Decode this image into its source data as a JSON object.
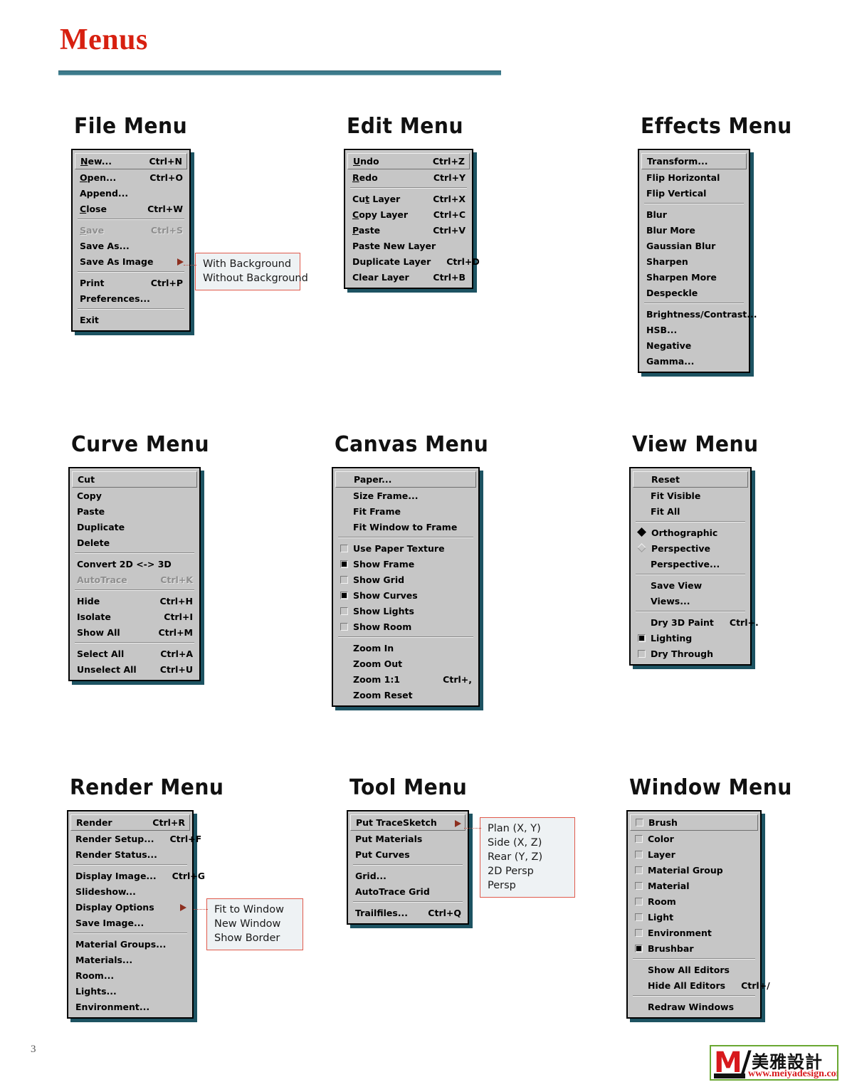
{
  "page": {
    "title": "Menus",
    "page_number": "3"
  },
  "logo": {
    "mark": "M",
    "slash": "/",
    "chinese": "美雅設計",
    "url": "www.meiyadesign.com",
    "border_color": "#6aa832",
    "red": "#d7191c"
  },
  "colors": {
    "title_red": "#d72010",
    "rule_teal": "#3d7b8c",
    "menu_face": "#c6c6c6",
    "menu_shadow": "#1d5362",
    "callout_border": "#e05a4c",
    "callout_fill": "#eef2f4",
    "disabled_text": "#8e8e8e"
  },
  "menus": [
    {
      "id": "file",
      "heading": "File Menu",
      "items": [
        {
          "label": "New...",
          "accel": "Ctrl+N",
          "selected": true,
          "mnemonic": 1
        },
        {
          "label": "Open...",
          "accel": "Ctrl+O",
          "mnemonic": 1
        },
        {
          "label": "Append...",
          "accel": ""
        },
        {
          "label": "Close",
          "accel": "Ctrl+W",
          "mnemonic": 1
        },
        {
          "separator": true
        },
        {
          "label": "Save",
          "accel": "Ctrl+S",
          "disabled": true,
          "mnemonic": 1
        },
        {
          "label": "Save As...",
          "accel": ""
        },
        {
          "label": "Save As Image",
          "accel": "",
          "submenu": true
        },
        {
          "separator": true
        },
        {
          "label": "Print",
          "accel": "Ctrl+P"
        },
        {
          "label": "Preferences...",
          "accel": ""
        },
        {
          "separator": true
        },
        {
          "label": "Exit",
          "accel": ""
        }
      ],
      "callout": {
        "lines": [
          "With Background",
          "Without Background"
        ]
      }
    },
    {
      "id": "edit",
      "heading": "Edit Menu",
      "items": [
        {
          "label": "Undo",
          "accel": "Ctrl+Z",
          "selected": true,
          "mnemonic": 1
        },
        {
          "label": "Redo",
          "accel": "Ctrl+Y",
          "mnemonic": 1
        },
        {
          "separator": true
        },
        {
          "label": "Cut Layer",
          "accel": "Ctrl+X",
          "mnemonic": 3
        },
        {
          "label": "Copy Layer",
          "accel": "Ctrl+C",
          "mnemonic": 1
        },
        {
          "label": "Paste",
          "accel": "Ctrl+V",
          "mnemonic": 1
        },
        {
          "label": "Paste New Layer",
          "accel": ""
        },
        {
          "label": "Duplicate Layer",
          "accel": "Ctrl+D"
        },
        {
          "label": "Clear Layer",
          "accel": "Ctrl+B"
        }
      ]
    },
    {
      "id": "effects",
      "heading": "Effects Menu",
      "items": [
        {
          "label": "Transform...",
          "accel": "",
          "selected": true
        },
        {
          "label": "Flip Horizontal",
          "accel": ""
        },
        {
          "label": "Flip Vertical",
          "accel": ""
        },
        {
          "separator": true
        },
        {
          "label": "Blur",
          "accel": ""
        },
        {
          "label": "Blur More",
          "accel": ""
        },
        {
          "label": "Gaussian Blur",
          "accel": ""
        },
        {
          "label": "Sharpen",
          "accel": ""
        },
        {
          "label": "Sharpen More",
          "accel": ""
        },
        {
          "label": "Despeckle",
          "accel": ""
        },
        {
          "separator": true
        },
        {
          "label": "Brightness/Contrast...",
          "accel": ""
        },
        {
          "label": "HSB...",
          "accel": ""
        },
        {
          "label": "Negative",
          "accel": ""
        },
        {
          "label": "Gamma...",
          "accel": ""
        }
      ]
    },
    {
      "id": "curve",
      "heading": "Curve Menu",
      "items": [
        {
          "label": "Cut",
          "accel": "",
          "selected": true
        },
        {
          "label": "Copy",
          "accel": ""
        },
        {
          "label": "Paste",
          "accel": ""
        },
        {
          "label": "Duplicate",
          "accel": ""
        },
        {
          "label": "Delete",
          "accel": ""
        },
        {
          "separator": true
        },
        {
          "label": "Convert 2D <-> 3D",
          "accel": ""
        },
        {
          "label": "AutoTrace",
          "accel": "Ctrl+K",
          "disabled": true
        },
        {
          "separator": true
        },
        {
          "label": "Hide",
          "accel": "Ctrl+H"
        },
        {
          "label": "Isolate",
          "accel": "Ctrl+I"
        },
        {
          "label": "Show All",
          "accel": "Ctrl+M"
        },
        {
          "separator": true
        },
        {
          "label": "Select All",
          "accel": "Ctrl+A"
        },
        {
          "label": "Unselect All",
          "accel": "Ctrl+U"
        }
      ]
    },
    {
      "id": "canvas",
      "heading": "Canvas Menu",
      "items": [
        {
          "label": "Paper...",
          "accel": "",
          "selected": true,
          "indent": true
        },
        {
          "label": "Size Frame...",
          "accel": "",
          "indent": true
        },
        {
          "label": "Fit Frame",
          "accel": "",
          "indent": true
        },
        {
          "label": "Fit Window to Frame",
          "accel": "",
          "indent": true
        },
        {
          "separator": true
        },
        {
          "label": "Use Paper Texture",
          "accel": "",
          "checkbox": false
        },
        {
          "label": "Show Frame",
          "accel": "",
          "checkbox": true
        },
        {
          "label": "Show Grid",
          "accel": "",
          "checkbox": false
        },
        {
          "label": "Show Curves",
          "accel": "",
          "checkbox": true
        },
        {
          "label": "Show Lights",
          "accel": "",
          "checkbox": false
        },
        {
          "label": "Show Room",
          "accel": "",
          "checkbox": false
        },
        {
          "separator": true
        },
        {
          "label": "Zoom In",
          "accel": "",
          "indent": true
        },
        {
          "label": "Zoom Out",
          "accel": "",
          "indent": true
        },
        {
          "label": "Zoom 1:1",
          "accel": "Ctrl+,",
          "indent": true
        },
        {
          "label": "Zoom Reset",
          "accel": "",
          "indent": true
        }
      ]
    },
    {
      "id": "view",
      "heading": "View Menu",
      "items": [
        {
          "label": "Reset",
          "accel": "",
          "selected": true,
          "indent": true
        },
        {
          "label": "Fit Visible",
          "accel": "",
          "indent": true
        },
        {
          "label": "Fit All",
          "accel": "",
          "indent": true
        },
        {
          "separator": true
        },
        {
          "label": "Orthographic",
          "accel": "",
          "radio": true
        },
        {
          "label": "Perspective",
          "accel": "",
          "radio": false
        },
        {
          "label": "Perspective...",
          "accel": "",
          "indent": true
        },
        {
          "separator": true
        },
        {
          "label": "Save View",
          "accel": "",
          "indent": true
        },
        {
          "label": "Views...",
          "accel": "",
          "indent": true
        },
        {
          "separator": true
        },
        {
          "label": "Dry 3D Paint",
          "accel": "Ctrl+.",
          "indent": true
        },
        {
          "label": "Lighting",
          "accel": "",
          "checkbox": true
        },
        {
          "label": "Dry Through",
          "accel": "",
          "checkbox": false
        }
      ]
    },
    {
      "id": "render",
      "heading": "Render Menu",
      "items": [
        {
          "label": "Render",
          "accel": "Ctrl+R",
          "selected": true
        },
        {
          "label": "Render Setup...",
          "accel": "Ctrl+F"
        },
        {
          "label": "Render Status...",
          "accel": ""
        },
        {
          "separator": true
        },
        {
          "label": "Display Image...",
          "accel": "Ctrl+G"
        },
        {
          "label": "Slideshow...",
          "accel": ""
        },
        {
          "label": "Display Options",
          "accel": "",
          "submenu": true
        },
        {
          "label": "Save Image...",
          "accel": ""
        },
        {
          "separator": true
        },
        {
          "label": "Material Groups...",
          "accel": ""
        },
        {
          "label": "Materials...",
          "accel": ""
        },
        {
          "label": "Room...",
          "accel": ""
        },
        {
          "label": "Lights...",
          "accel": ""
        },
        {
          "label": "Environment...",
          "accel": ""
        }
      ],
      "callout": {
        "lines": [
          "Fit to Window",
          "New Window",
          "Show Border"
        ]
      }
    },
    {
      "id": "tool",
      "heading": "Tool Menu",
      "items": [
        {
          "label": "Put TraceSketch",
          "accel": "",
          "selected": true,
          "submenu": true
        },
        {
          "label": "Put Materials",
          "accel": ""
        },
        {
          "label": "Put Curves",
          "accel": ""
        },
        {
          "separator": true
        },
        {
          "label": "Grid...",
          "accel": ""
        },
        {
          "label": "AutoTrace Grid",
          "accel": ""
        },
        {
          "separator": true
        },
        {
          "label": "Trailfiles...",
          "accel": "Ctrl+Q"
        }
      ],
      "callout": {
        "lines": [
          "Plan (X, Y)",
          "Side (X, Z)",
          "Rear (Y, Z)",
          "2D Persp",
          "Persp"
        ]
      }
    },
    {
      "id": "window",
      "heading": "Window Menu",
      "items": [
        {
          "label": "Brush",
          "accel": "",
          "checkbox": false,
          "selected": true
        },
        {
          "label": "Color",
          "accel": "",
          "checkbox": false
        },
        {
          "label": "Layer",
          "accel": "",
          "checkbox": false
        },
        {
          "label": "Material Group",
          "accel": "",
          "checkbox": false
        },
        {
          "label": "Material",
          "accel": "",
          "checkbox": false
        },
        {
          "label": "Room",
          "accel": "",
          "checkbox": false
        },
        {
          "label": "Light",
          "accel": "",
          "checkbox": false
        },
        {
          "label": "Environment",
          "accel": "",
          "checkbox": false
        },
        {
          "label": "Brushbar",
          "accel": "",
          "checkbox": true
        },
        {
          "separator": true
        },
        {
          "label": "Show All Editors",
          "accel": "",
          "indent": true
        },
        {
          "label": "Hide All Editors",
          "accel": "Ctrl+/",
          "indent": true
        },
        {
          "separator": true
        },
        {
          "label": "Redraw Windows",
          "accel": "",
          "indent": true
        }
      ]
    }
  ]
}
